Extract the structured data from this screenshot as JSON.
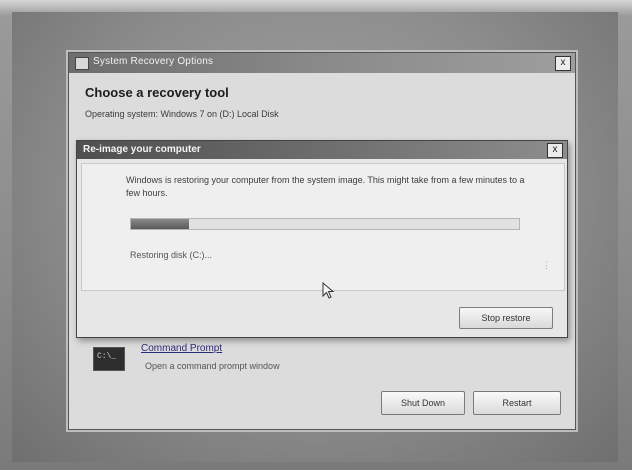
{
  "outer_window": {
    "title": "System Recovery Options",
    "heading": "Choose a recovery tool",
    "os_line": "Operating system: Windows 7 on (D:) Local Disk",
    "close_label": "x",
    "tools": [
      {
        "title": "Command Prompt",
        "description": "Open a command prompt window",
        "icon": "command-prompt-icon"
      }
    ],
    "buttons": {
      "shutdown": "Shut Down",
      "restart": "Restart"
    }
  },
  "dialog": {
    "title": "Re-image your computer",
    "close_label": "x",
    "message": "Windows is restoring your computer from the system image. This might take from a few minutes to a few hours.",
    "progress": 0.15,
    "status": "Restoring disk (C:)...",
    "stop_button": "Stop restore"
  }
}
